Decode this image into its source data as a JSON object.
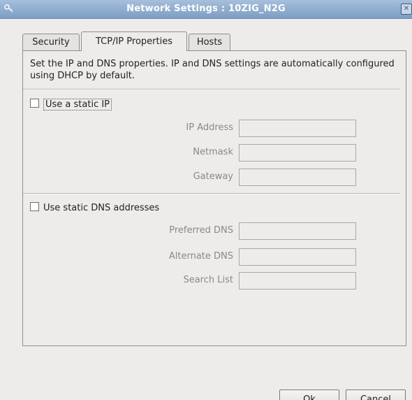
{
  "window": {
    "title": "Network Settings : 10ZIG_N2G",
    "app_icon": "key-icon",
    "close_glyph": "✕"
  },
  "tabs": [
    {
      "label": "Security",
      "active": false
    },
    {
      "label": "TCP/IP Properties",
      "active": true
    },
    {
      "label": "Hosts",
      "active": false
    }
  ],
  "tcpip": {
    "description": "Set the IP and DNS properties. IP and DNS settings are automatically configured using DHCP by default.",
    "static_ip": {
      "label": "Use a static IP",
      "checked": false,
      "fields": {
        "ip_address": {
          "label": "IP Address",
          "value": ""
        },
        "netmask": {
          "label": "Netmask",
          "value": ""
        },
        "gateway": {
          "label": "Gateway",
          "value": ""
        }
      }
    },
    "static_dns": {
      "label": "Use static DNS addresses",
      "checked": false,
      "fields": {
        "preferred_dns": {
          "label": "Preferred DNS",
          "value": ""
        },
        "alternate_dns": {
          "label": "Alternate DNS",
          "value": ""
        },
        "search_list": {
          "label": "Search List",
          "value": ""
        }
      }
    }
  },
  "buttons": {
    "ok": "Ok",
    "cancel": "Cancel"
  }
}
